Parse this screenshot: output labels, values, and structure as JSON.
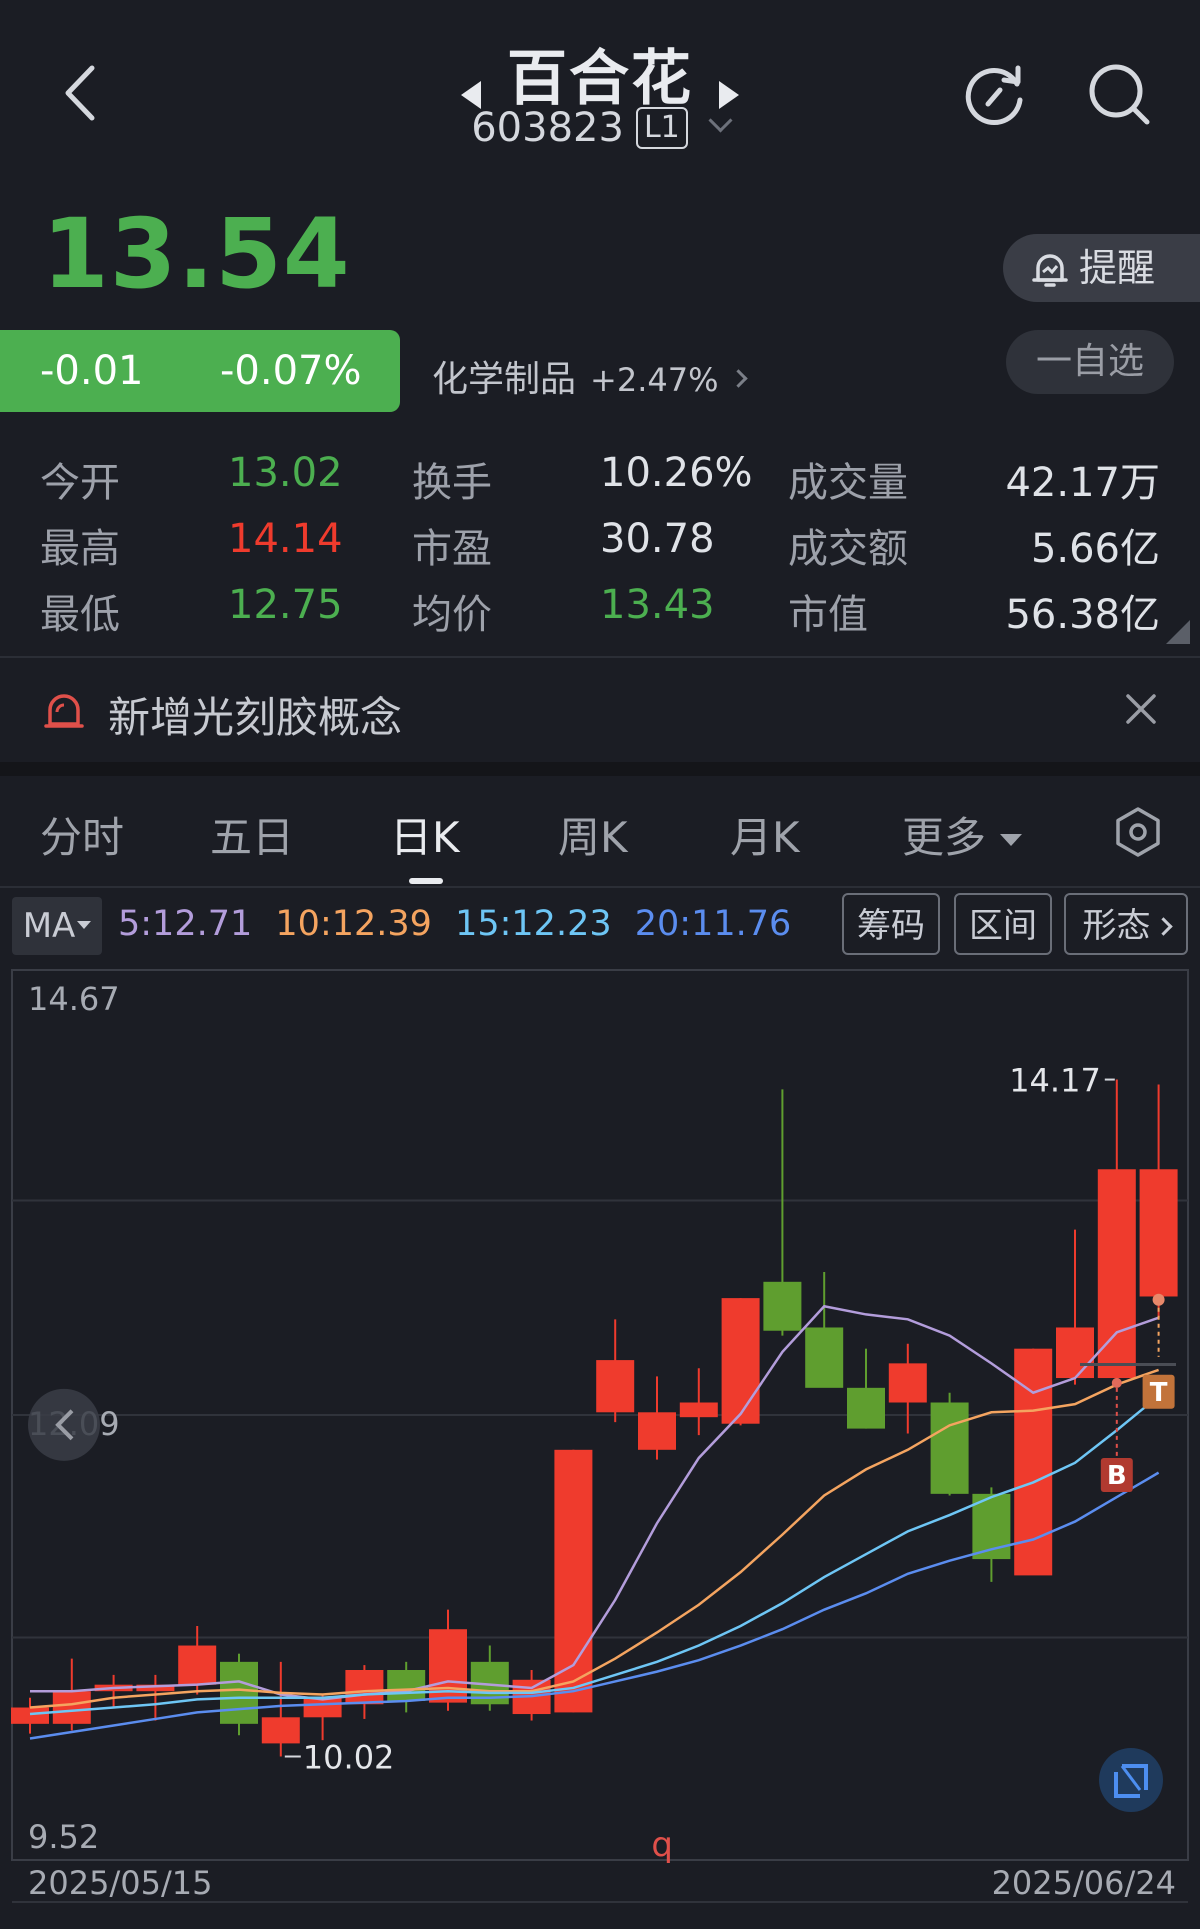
{
  "header": {
    "stock_name": "百合花",
    "stock_code": "603823",
    "level_badge": "L1"
  },
  "quote": {
    "price": "13.54",
    "change": "-0.01",
    "change_pct": "-0.07%",
    "industry": "化学制品",
    "industry_change": "+2.47%",
    "remind_label": "提醒",
    "watchlist_label": "一自选",
    "price_color": "#4caf50"
  },
  "stats": [
    {
      "label": "今开",
      "value": "13.02",
      "color": "green"
    },
    {
      "label": "换手",
      "value": "10.26%",
      "color": "neutral"
    },
    {
      "label": "成交量",
      "value": "42.17万",
      "color": "neutral"
    },
    {
      "label": "最高",
      "value": "14.14",
      "color": "red"
    },
    {
      "label": "市盈",
      "value": "30.78",
      "color": "neutral"
    },
    {
      "label": "成交额",
      "value": "5.66亿",
      "color": "neutral"
    },
    {
      "label": "最低",
      "value": "12.75",
      "color": "green"
    },
    {
      "label": "均价",
      "value": "13.43",
      "color": "green"
    },
    {
      "label": "市值",
      "value": "56.38亿",
      "color": "neutral"
    }
  ],
  "notice": {
    "text": "新增光刻胶概念"
  },
  "tabs": [
    {
      "label": "分时",
      "active": false
    },
    {
      "label": "五日",
      "active": false
    },
    {
      "label": "日K",
      "active": true
    },
    {
      "label": "周K",
      "active": false
    },
    {
      "label": "月K",
      "active": false
    },
    {
      "label": "更多",
      "active": false
    }
  ],
  "indicator": {
    "ma_label": "MA",
    "ma5": "5:12.71",
    "ma10": "10:12.39",
    "ma15": "15:12.23",
    "ma20": "20:11.76",
    "ma5_color": "#b39ddb",
    "ma10_color": "#f4a460",
    "ma15_color": "#6ec6f5",
    "ma20_color": "#5b8def",
    "chips_label": "筹码",
    "range_label": "区间",
    "pattern_label": "形态"
  },
  "chart_data": {
    "type": "candlestick",
    "ylim": [
      9.52,
      14.67
    ],
    "y_ticks": [
      "14.67",
      "12.09",
      "9.52"
    ],
    "x_start_label": "2025/05/15",
    "x_end_label": "2025/06/24",
    "high_marker": "14.17",
    "low_marker": "10.02",
    "markers": {
      "buy": "B",
      "take_profit": "T",
      "event": "q"
    },
    "up_color": "#ef3b2d",
    "down_color": "#5f9e2f",
    "candles": [
      {
        "o": 10.22,
        "c": 10.32,
        "h": 10.38,
        "l": 10.16
      },
      {
        "o": 10.22,
        "c": 10.42,
        "h": 10.62,
        "l": 10.18
      },
      {
        "o": 10.42,
        "c": 10.46,
        "h": 10.52,
        "l": 10.32
      },
      {
        "o": 10.42,
        "c": 10.46,
        "h": 10.52,
        "l": 10.24
      },
      {
        "o": 10.46,
        "c": 10.7,
        "h": 10.82,
        "l": 10.4
      },
      {
        "o": 10.6,
        "c": 10.22,
        "h": 10.65,
        "l": 10.15
      },
      {
        "o": 10.1,
        "c": 10.26,
        "h": 10.6,
        "l": 10.02
      },
      {
        "o": 10.26,
        "c": 10.38,
        "h": 10.4,
        "l": 10.12
      },
      {
        "o": 10.34,
        "c": 10.55,
        "h": 10.58,
        "l": 10.25
      },
      {
        "o": 10.55,
        "c": 10.36,
        "h": 10.6,
        "l": 10.29
      },
      {
        "o": 10.35,
        "c": 10.8,
        "h": 10.92,
        "l": 10.3
      },
      {
        "o": 10.6,
        "c": 10.34,
        "h": 10.7,
        "l": 10.3
      },
      {
        "o": 10.28,
        "c": 10.49,
        "h": 10.55,
        "l": 10.24
      },
      {
        "o": 10.29,
        "c": 11.9,
        "h": 11.9,
        "l": 10.29
      },
      {
        "o": 12.13,
        "c": 12.45,
        "h": 12.7,
        "l": 12.07
      },
      {
        "o": 11.9,
        "c": 12.13,
        "h": 12.35,
        "l": 11.84
      },
      {
        "o": 12.1,
        "c": 12.19,
        "h": 12.4,
        "l": 11.99
      },
      {
        "o": 12.06,
        "c": 12.83,
        "h": 12.83,
        "l": 12.05
      },
      {
        "o": 12.93,
        "c": 12.63,
        "h": 14.11,
        "l": 12.6
      },
      {
        "o": 12.65,
        "c": 12.28,
        "h": 12.99,
        "l": 12.29
      },
      {
        "o": 12.28,
        "c": 12.03,
        "h": 12.52,
        "l": 12.03
      },
      {
        "o": 12.19,
        "c": 12.43,
        "h": 12.55,
        "l": 12.0
      },
      {
        "o": 12.19,
        "c": 11.63,
        "h": 12.25,
        "l": 11.62
      },
      {
        "o": 11.63,
        "c": 11.23,
        "h": 11.67,
        "l": 11.09
      },
      {
        "o": 11.13,
        "c": 12.52,
        "h": 12.52,
        "l": 11.14
      },
      {
        "o": 12.34,
        "c": 12.65,
        "h": 13.25,
        "l": 12.3
      },
      {
        "o": 12.34,
        "c": 13.62,
        "h": 14.17,
        "l": 12.31
      },
      {
        "o": 12.84,
        "c": 13.62,
        "h": 14.14,
        "l": 12.71
      }
    ],
    "series": [
      {
        "name": "MA5",
        "values": [
          10.42,
          10.42,
          10.44,
          10.45,
          10.46,
          10.48,
          10.4,
          10.37,
          10.4,
          10.42,
          10.48,
          10.46,
          10.44,
          10.58,
          10.98,
          11.45,
          11.85,
          12.12,
          12.5,
          12.78,
          12.73,
          12.7,
          12.6,
          12.43,
          12.25,
          12.34,
          12.62,
          12.71
        ]
      },
      {
        "name": "MA10",
        "values": [
          10.32,
          10.34,
          10.38,
          10.4,
          10.42,
          10.43,
          10.41,
          10.4,
          10.42,
          10.43,
          10.44,
          10.42,
          10.42,
          10.48,
          10.62,
          10.78,
          10.95,
          11.15,
          11.38,
          11.62,
          11.78,
          11.9,
          12.05,
          12.13,
          12.14,
          12.18,
          12.3,
          12.39
        ]
      },
      {
        "name": "MA15",
        "values": [
          10.28,
          10.3,
          10.32,
          10.34,
          10.37,
          10.38,
          10.38,
          10.38,
          10.4,
          10.41,
          10.42,
          10.41,
          10.41,
          10.44,
          10.52,
          10.6,
          10.7,
          10.82,
          10.96,
          11.12,
          11.26,
          11.4,
          11.5,
          11.61,
          11.7,
          11.82,
          12.02,
          12.23
        ]
      },
      {
        "name": "MA20",
        "values": [
          10.13,
          10.17,
          10.21,
          10.25,
          10.29,
          10.31,
          10.33,
          10.34,
          10.35,
          10.36,
          10.38,
          10.38,
          10.39,
          10.42,
          10.48,
          10.54,
          10.61,
          10.7,
          10.8,
          10.92,
          11.02,
          11.14,
          11.22,
          11.29,
          11.35,
          11.46,
          11.61,
          11.76
        ]
      }
    ]
  }
}
